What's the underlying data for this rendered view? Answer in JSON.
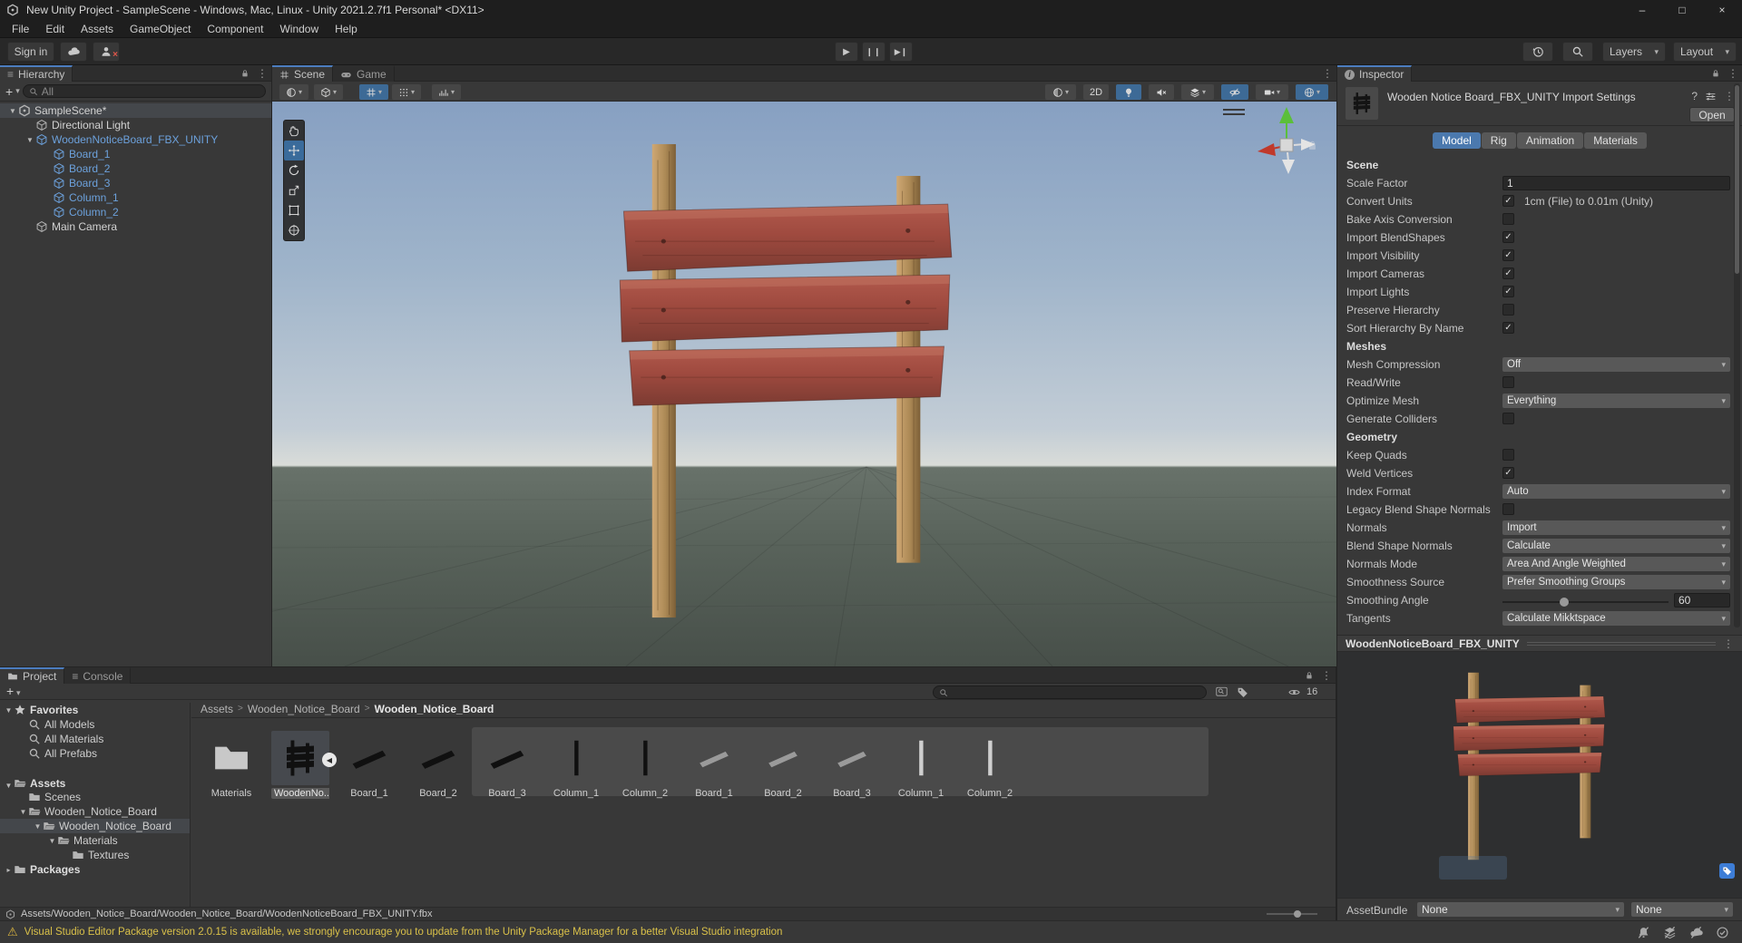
{
  "window": {
    "title": "New Unity Project - SampleScene - Windows, Mac, Linux - Unity 2021.2.7f1 Personal* <DX11>"
  },
  "menu": {
    "items": [
      "File",
      "Edit",
      "Assets",
      "GameObject",
      "Component",
      "Window",
      "Help"
    ]
  },
  "toolbar": {
    "sign_in": "Sign in",
    "layers": "Layers",
    "layout": "Layout"
  },
  "icons": {
    "dropdown_arrow": "▾",
    "kebab": "⋮",
    "hamburger": "≡",
    "plus": "+",
    "back_badge": "◀",
    "warning": "⚠",
    "breadcrumb_sep": ">",
    "check": "✓",
    "expanded": "▼",
    "collapsed": "▸",
    "minimize": "–",
    "maximize": "□",
    "close": "×",
    "info": "i",
    "question": "?"
  },
  "hierarchy": {
    "tab": "Hierarchy",
    "search_placeholder": "All",
    "items": [
      {
        "label": "SampleScene*",
        "depth": 0,
        "kind": "scene",
        "selected": true,
        "expand": "open"
      },
      {
        "label": "Directional Light",
        "depth": 1,
        "kind": "object"
      },
      {
        "label": "WoodenNoticeBoard_FBX_UNITY",
        "depth": 1,
        "kind": "prefab",
        "expand": "open"
      },
      {
        "label": "Board_1",
        "depth": 2,
        "kind": "prefab"
      },
      {
        "label": "Board_2",
        "depth": 2,
        "kind": "prefab"
      },
      {
        "label": "Board_3",
        "depth": 2,
        "kind": "prefab"
      },
      {
        "label": "Column_1",
        "depth": 2,
        "kind": "prefab"
      },
      {
        "label": "Column_2",
        "depth": 2,
        "kind": "prefab"
      },
      {
        "label": "Main Camera",
        "depth": 1,
        "kind": "object"
      }
    ]
  },
  "scene_view": {
    "tab_scene": "Scene",
    "tab_game": "Game",
    "mode_2d": "2D"
  },
  "inspector": {
    "tab": "Inspector",
    "title": "Wooden Notice Board_FBX_UNITY Import Settings",
    "open_label": "Open",
    "tabs": [
      "Model",
      "Rig",
      "Animation",
      "Materials"
    ],
    "active_tab": "Model",
    "rows": [
      {
        "type": "header",
        "label": "Scene"
      },
      {
        "type": "text",
        "label": "Scale Factor",
        "value": "1"
      },
      {
        "type": "check",
        "label": "Convert Units",
        "checked": true,
        "note": "1cm (File) to 0.01m (Unity)"
      },
      {
        "type": "check",
        "label": "Bake Axis Conversion",
        "checked": false
      },
      {
        "type": "check",
        "label": "Import BlendShapes",
        "checked": true
      },
      {
        "type": "check",
        "label": "Import Visibility",
        "checked": true
      },
      {
        "type": "check",
        "label": "Import Cameras",
        "checked": true
      },
      {
        "type": "check",
        "label": "Import Lights",
        "checked": true
      },
      {
        "type": "check",
        "label": "Preserve Hierarchy",
        "checked": false
      },
      {
        "type": "check",
        "label": "Sort Hierarchy By Name",
        "checked": true
      },
      {
        "type": "header",
        "label": "Meshes"
      },
      {
        "type": "dropdown",
        "label": "Mesh Compression",
        "value": "Off"
      },
      {
        "type": "check",
        "label": "Read/Write",
        "checked": false
      },
      {
        "type": "dropdown",
        "label": "Optimize Mesh",
        "value": "Everything"
      },
      {
        "type": "check",
        "label": "Generate Colliders",
        "checked": false
      },
      {
        "type": "header",
        "label": "Geometry"
      },
      {
        "type": "check",
        "label": "Keep Quads",
        "checked": false
      },
      {
        "type": "check",
        "label": "Weld Vertices",
        "checked": true
      },
      {
        "type": "dropdown",
        "label": "Index Format",
        "value": "Auto"
      },
      {
        "type": "check",
        "label": "Legacy Blend Shape Normals",
        "checked": false
      },
      {
        "type": "dropdown",
        "label": "Normals",
        "value": "Import"
      },
      {
        "type": "dropdown",
        "label": "Blend Shape Normals",
        "value": "Calculate"
      },
      {
        "type": "dropdown",
        "label": "Normals Mode",
        "value": "Area And Angle Weighted"
      },
      {
        "type": "dropdown",
        "label": "Smoothness Source",
        "value": "Prefer Smoothing Groups"
      },
      {
        "type": "slider",
        "label": "Smoothing Angle",
        "value": "60",
        "percent": 37
      },
      {
        "type": "dropdown",
        "label": "Tangents",
        "value": "Calculate Mikktspace"
      }
    ],
    "preview_title": "WoodenNoticeBoard_FBX_UNITY",
    "assetbundle_label": "AssetBundle",
    "assetbundle_value": "None",
    "assetbundle_variant": "None"
  },
  "project": {
    "tab_project": "Project",
    "tab_console": "Console",
    "hidden_count": "16",
    "tree": [
      {
        "label": "Favorites",
        "depth": 0,
        "icon": "star",
        "expand": "open",
        "bold": true
      },
      {
        "label": "All Models",
        "depth": 1,
        "icon": "search"
      },
      {
        "label": "All Materials",
        "depth": 1,
        "icon": "search"
      },
      {
        "label": "All Prefabs",
        "depth": 1,
        "icon": "search"
      },
      {
        "label": "Assets",
        "depth": 0,
        "icon": "folder-open",
        "expand": "open",
        "bold": true,
        "gap": true
      },
      {
        "label": "Scenes",
        "depth": 1,
        "icon": "folder"
      },
      {
        "label": "Wooden_Notice_Board",
        "depth": 1,
        "icon": "folder-open",
        "expand": "open"
      },
      {
        "label": "Wooden_Notice_Board",
        "depth": 2,
        "icon": "folder-open",
        "expand": "open",
        "selected": true
      },
      {
        "label": "Materials",
        "depth": 3,
        "icon": "folder-open",
        "expand": "open"
      },
      {
        "label": "Textures",
        "depth": 4,
        "icon": "folder"
      },
      {
        "label": "Packages",
        "depth": 0,
        "icon": "folder",
        "expand": "closed",
        "bold": true
      }
    ],
    "breadcrumb": [
      "Assets",
      "Wooden_Notice_Board",
      "Wooden_Notice_Board"
    ],
    "tiles": [
      {
        "label": "Materials",
        "glyph": "folder"
      },
      {
        "label": "WoodenNo...",
        "glyph": "sign",
        "selected": true,
        "badge": true
      },
      {
        "label": "Board_1",
        "glyph": "plank-dark"
      },
      {
        "label": "Board_2",
        "glyph": "plank-dark"
      },
      {
        "label": "Board_3",
        "glyph": "plank-dark"
      },
      {
        "label": "Column_1",
        "glyph": "column-dark"
      },
      {
        "label": "Column_2",
        "glyph": "column-dark"
      },
      {
        "label": "Board_1",
        "glyph": "plank-light"
      },
      {
        "label": "Board_2",
        "glyph": "plank-light"
      },
      {
        "label": "Board_3",
        "glyph": "plank-light"
      },
      {
        "label": "Column_1",
        "glyph": "column-light"
      },
      {
        "label": "Column_2",
        "glyph": "column-light"
      }
    ],
    "footer_path": "Assets/Wooden_Notice_Board/Wooden_Notice_Board/WoodenNoticeBoard_FBX_UNITY.fbx"
  },
  "status": {
    "warning": "Visual Studio Editor Package version 2.0.15 is available, we strongly encourage you to update from the Unity Package Manager for a better Visual Studio integration"
  },
  "colors": {
    "accent_tab_line": "#4c7dbf",
    "prefab_text": "#6ca1dc",
    "selection": "#44474b",
    "model_tab_active": "#4b79ae",
    "warning_text": "#d9c049",
    "sky_top": "#87a0c2",
    "ground": "#59635b"
  }
}
